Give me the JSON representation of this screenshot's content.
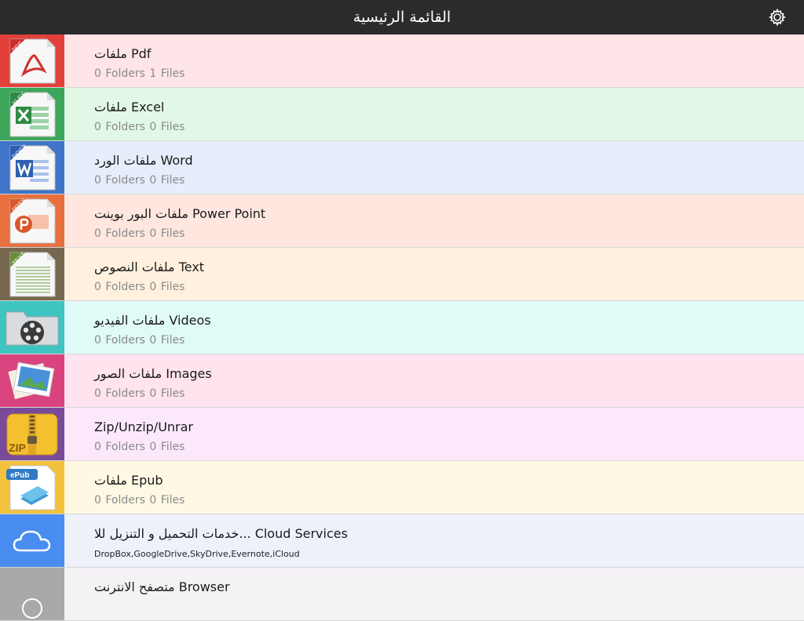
{
  "header": {
    "title": "القائمة الرئيسية",
    "settings_icon": "gear-icon"
  },
  "rows": [
    {
      "name": "ملفات Pdf",
      "meta": "0  Folders 1  Files",
      "icon": "pdf-file-icon",
      "tag": "PDF",
      "bg": "#ffe4e8",
      "tile": "#e2413b"
    },
    {
      "name": "ملفات Excel",
      "meta": "0  Folders 0  Files",
      "icon": "excel-file-icon",
      "tag": "XLSX",
      "bg": "#e2f8e6",
      "tile": "#3ca65a"
    },
    {
      "name": "ملفات الورد Word",
      "meta": "0  Folders 0  Files",
      "icon": "word-file-icon",
      "tag": "DOCX",
      "bg": "#e6eefc",
      "tile": "#3f74c9"
    },
    {
      "name": "ملفات البور بوينت Power Point",
      "meta": "0  Folders 0  Files",
      "icon": "powerpoint-file-icon",
      "tag": "PPTX",
      "bg": "#ffe7e0",
      "tile": "#e8703f"
    },
    {
      "name": "ملفات النصوص Text",
      "meta": "0  Folders 0  Files",
      "icon": "text-file-icon",
      "tag": "TEXT",
      "bg": "#fff1de",
      "tile": "#76674f"
    },
    {
      "name": "ملفات الفيديو Videos",
      "meta": "0  Folders 0  Files",
      "icon": "video-reel-icon",
      "tag": "",
      "bg": "#e0faf8",
      "tile": "#3ec5c1"
    },
    {
      "name": "ملفات الصور Images",
      "meta": "0  Folders 0  Files",
      "icon": "images-icon",
      "tag": "",
      "bg": "#ffe3ee",
      "tile": "#d9447e"
    },
    {
      "name": "Zip/Unzip/Unrar",
      "meta": "0  Folders 0  Files",
      "icon": "zip-archive-icon",
      "tag": "ZIP",
      "bg": "#fbe9fb",
      "tile": "#7a4a9a"
    },
    {
      "name": "ملفات Epub",
      "meta": "0  Folders 0  Files",
      "icon": "epub-book-icon",
      "tag": "ePub",
      "bg": "#fff9e3",
      "tile": "#f2c23d"
    },
    {
      "name": "خدمات التحميل و التنزيل للا... Cloud Services",
      "meta": "DropBox,GoogleDrive,SkyDrive,Evernote,iCloud",
      "icon": "cloud-icon",
      "tag": "",
      "bg": "#eef0fa",
      "tile": "#4a8df0"
    },
    {
      "name": "متصفح الانترنت Browser",
      "meta": "",
      "icon": "compass-icon",
      "tag": "",
      "bg": "#f5f2f6",
      "tile": "#a9a9a9"
    }
  ]
}
